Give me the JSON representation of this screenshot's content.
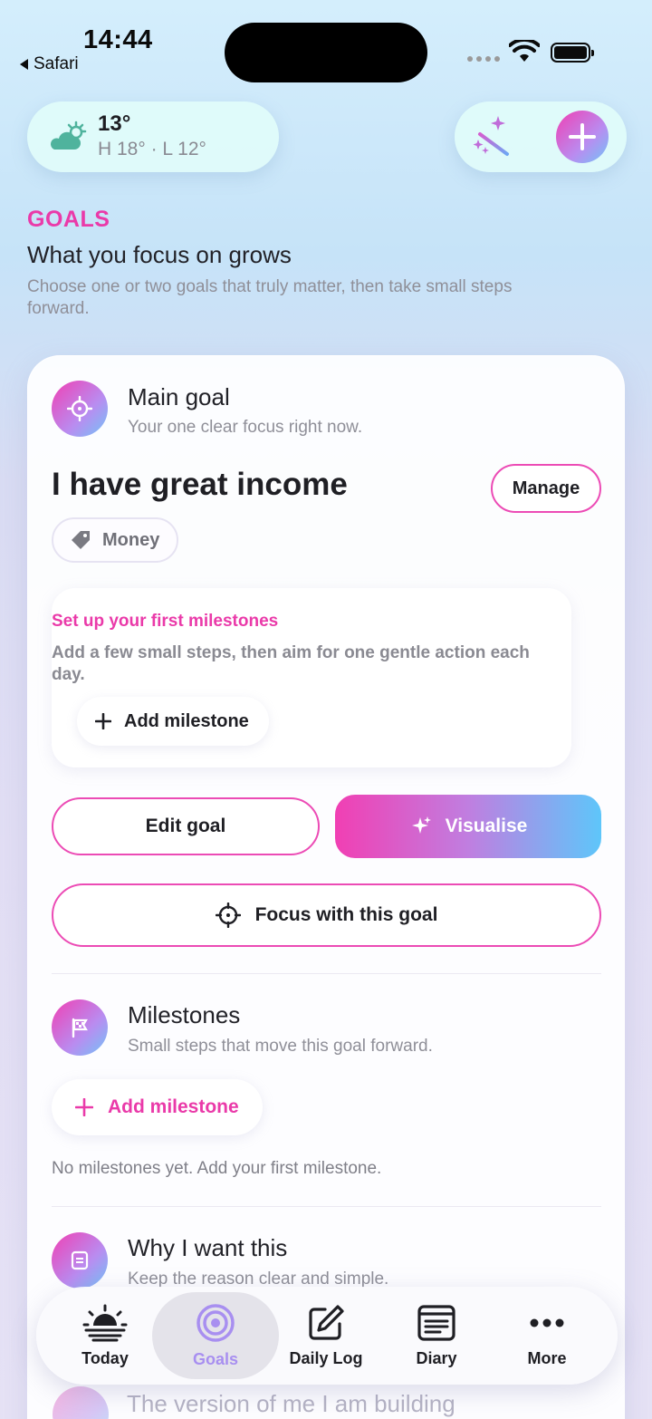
{
  "status_bar": {
    "time": "14:44",
    "back_app": "Safari"
  },
  "weather": {
    "temp": "13°",
    "high_low": "H 18° · L 12°",
    "icon": "partly-cloudy-icon"
  },
  "header": {
    "eyebrow": "GOALS",
    "headline": "What you focus on grows",
    "subtitle": "Choose one or two goals that truly matter, then take small steps forward."
  },
  "main_goal": {
    "section_title": "Main goal",
    "section_sub": "Your one clear focus right now.",
    "goal_title": "I have great income",
    "manage_label": "Manage",
    "tag": "Money",
    "setup": {
      "title": "Set up your first milestones",
      "text": "Add a few small steps, then aim for one gentle action each day.",
      "add_label": "Add milestone"
    },
    "edit_label": "Edit goal",
    "visualise_label": "Visualise",
    "focus_label": "Focus with this goal"
  },
  "milestones": {
    "title": "Milestones",
    "sub": "Small steps that move this goal forward.",
    "add_label": "Add milestone",
    "empty": "No milestones yet. Add your first milestone."
  },
  "why": {
    "title": "Why I want this",
    "sub": "Keep the reason clear and simple."
  },
  "version": {
    "title": "The version of me I am building"
  },
  "tabs": [
    {
      "label": "Today",
      "icon": "sunrise-icon"
    },
    {
      "label": "Goals",
      "icon": "target-icon",
      "active": true
    },
    {
      "label": "Daily Log",
      "icon": "edit-square-icon"
    },
    {
      "label": "Diary",
      "icon": "notebook-icon"
    },
    {
      "label": "More",
      "icon": "more-icon"
    }
  ],
  "colors": {
    "accent_pink": "#ea3aa9",
    "accent_blue": "#5ec6fa",
    "active_tab": "#a88ff0"
  }
}
